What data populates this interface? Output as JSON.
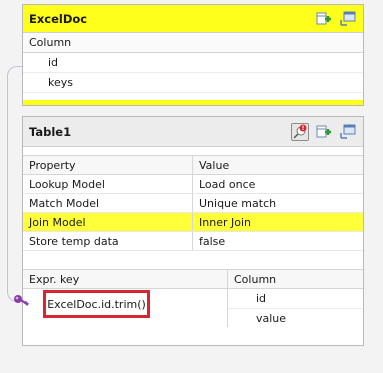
{
  "excel_panel": {
    "title": "ExcelDoc",
    "column_header": "Column",
    "rows": [
      "id",
      "keys"
    ]
  },
  "table_panel": {
    "title": "Table1",
    "properties_header": {
      "property": "Property",
      "value": "Value"
    },
    "properties": [
      {
        "property": "Lookup Model",
        "value": "Load once",
        "selected": false
      },
      {
        "property": "Match Model",
        "value": "Unique match",
        "selected": false
      },
      {
        "property": "Join Model",
        "value": "Inner Join",
        "selected": true
      },
      {
        "property": "Store temp data",
        "value": "false",
        "selected": false
      }
    ],
    "expr_header": {
      "expr_key": "Expr. key",
      "column": "Column"
    },
    "expr_rows": [
      {
        "expr": "ExcelDoc.id.trim()",
        "column": "id"
      },
      {
        "expr": "",
        "column": "value"
      }
    ]
  },
  "colors": {
    "highlight": "#ffff1c",
    "red_box": "#d7262f",
    "key_icon": "#8e3ba8",
    "connector": "#c9c0dc"
  },
  "icons": [
    "add-column-icon",
    "minimize-icon",
    "warning-filter-icon"
  ]
}
